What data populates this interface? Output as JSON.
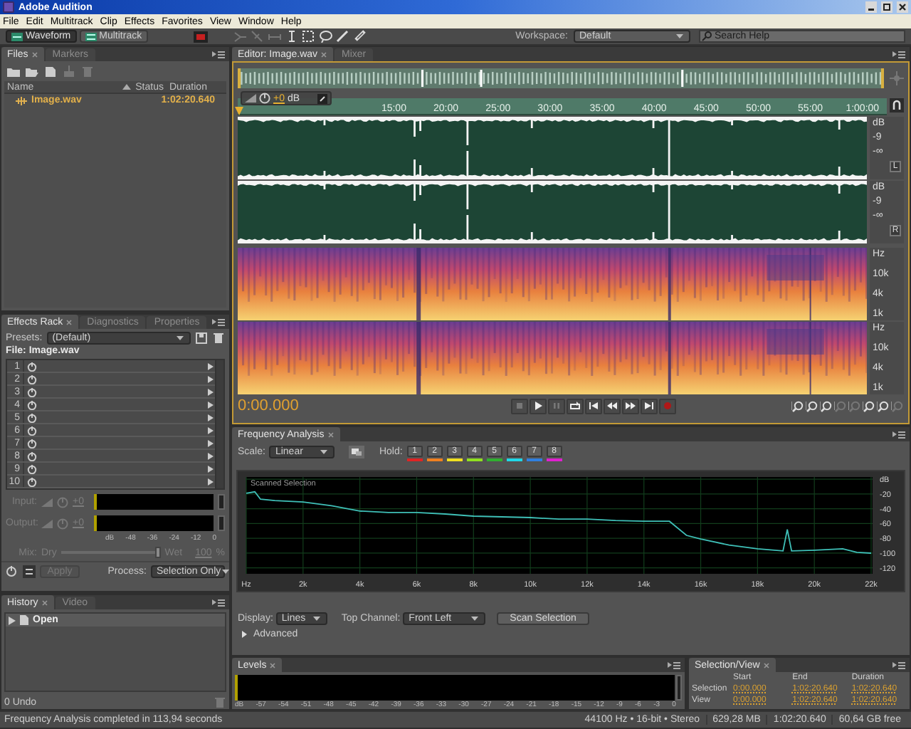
{
  "window": {
    "title": "Adobe Audition"
  },
  "menu": [
    "File",
    "Edit",
    "Multitrack",
    "Clip",
    "Effects",
    "Favorites",
    "View",
    "Window",
    "Help"
  ],
  "toolbar": {
    "views": [
      {
        "label": "Waveform",
        "selected": true
      },
      {
        "label": "Multitrack",
        "selected": false
      }
    ],
    "workspace_label": "Workspace:",
    "workspace": "Default",
    "search_placeholder": "Search Help"
  },
  "files_panel": {
    "tabs": [
      {
        "label": "Files",
        "selected": true
      },
      {
        "label": "Markers",
        "selected": false
      }
    ],
    "columns": [
      "Name",
      "Status",
      "Duration"
    ],
    "rows": [
      {
        "name": "Image.wav",
        "duration": "1:02:20.640"
      }
    ]
  },
  "effects_rack": {
    "tabs": [
      {
        "label": "Effects Rack",
        "selected": true
      },
      {
        "label": "Diagnostics",
        "selected": false
      },
      {
        "label": "Properties",
        "selected": false
      }
    ],
    "presets_label": "Presets:",
    "preset": "(Default)",
    "file_label": "File: Image.wav",
    "slots": [
      "1",
      "2",
      "3",
      "4",
      "5",
      "6",
      "7",
      "8",
      "9",
      "10"
    ],
    "input_label": "Input:",
    "input_value": "+0",
    "output_label": "Output:",
    "output_value": "+0",
    "meter_scale": [
      "dB",
      "-48",
      "-36",
      "-24",
      "-12",
      "0"
    ],
    "mix_label": "Mix:",
    "dry_label": "Dry",
    "wet_label": "Wet",
    "mix_slider": {
      "level": 1.0
    },
    "mix_value": "100",
    "mix_unit": "%",
    "apply": {
      "label": "Apply",
      "disabled": true
    },
    "process_label": "Process:",
    "process": "Selection Only"
  },
  "history": {
    "tabs": [
      {
        "label": "History",
        "selected": true
      },
      {
        "label": "Video",
        "selected": false
      }
    ],
    "items": [
      {
        "label": "Open"
      }
    ],
    "undo_count": "0 Undo"
  },
  "editor": {
    "tabs": [
      {
        "label": "Editor: Image.wav",
        "selected": true
      },
      {
        "label": "Mixer",
        "selected": false
      }
    ],
    "hud_gain": "+0",
    "hud_unit": "dB",
    "ruler": [
      "15:00",
      "20:00",
      "25:00",
      "30:00",
      "35:00",
      "40:00",
      "45:00",
      "50:00",
      "55:00",
      "1:00:00"
    ],
    "channels": [
      {
        "name": "L",
        "scale": [
          "dB",
          "-9",
          "-∞"
        ]
      },
      {
        "name": "R",
        "scale": [
          "dB",
          "-9",
          "-∞"
        ]
      }
    ],
    "spectral_scales": [
      [
        "Hz",
        "10k",
        "4k",
        "1k"
      ],
      [
        "Hz",
        "10k",
        "4k",
        "1k"
      ]
    ],
    "time": "0:00.000"
  },
  "frequency_analysis": {
    "title": "Frequency Analysis",
    "scale_label": "Scale:",
    "scale": "Linear",
    "hold_label": "Hold:",
    "holds": [
      {
        "label": "1",
        "color": "#e02424"
      },
      {
        "label": "2",
        "color": "#f08020"
      },
      {
        "label": "3",
        "color": "#f0e020"
      },
      {
        "label": "4",
        "color": "#90e020"
      },
      {
        "label": "5",
        "color": "#30b030"
      },
      {
        "label": "6",
        "color": "#20d8e8"
      },
      {
        "label": "7",
        "color": "#3080e0"
      },
      {
        "label": "8",
        "color": "#e020d0"
      }
    ],
    "chart_data": {
      "type": "line",
      "grid": true,
      "x": [
        0,
        300,
        500,
        1000,
        2000,
        3000,
        4000,
        5000,
        6000,
        7000,
        8000,
        9000,
        10000,
        11000,
        12000,
        13000,
        14000,
        14900,
        15500,
        16000,
        17000,
        18000,
        18900,
        19050,
        19200,
        20000,
        21000,
        21500,
        22000
      ],
      "series": [
        {
          "name": "Scanned Selection",
          "color": "#3fc0b8",
          "values": [
            -19,
            -17,
            -27,
            -29,
            -31,
            -36,
            -43,
            -45,
            -45,
            -47,
            -50,
            -51,
            -52,
            -54,
            -54,
            -56,
            -57,
            -57,
            -76,
            -81,
            -89,
            -94,
            -97,
            -68,
            -97,
            -96,
            -94,
            -99,
            -100
          ]
        }
      ],
      "xlim": [
        0,
        22050
      ],
      "ylim": [
        -128,
        3
      ],
      "xticks": [
        {
          "value": 0,
          "label": "Hz"
        },
        {
          "value": 2000,
          "label": "2k"
        },
        {
          "value": 4000,
          "label": "4k"
        },
        {
          "value": 6000,
          "label": "6k"
        },
        {
          "value": 8000,
          "label": "8k"
        },
        {
          "value": 10000,
          "label": "10k"
        },
        {
          "value": 12000,
          "label": "12k"
        },
        {
          "value": 14000,
          "label": "14k"
        },
        {
          "value": 16000,
          "label": "16k"
        },
        {
          "value": 18000,
          "label": "18k"
        },
        {
          "value": 20000,
          "label": "20k"
        },
        {
          "value": 22000,
          "label": "22k"
        }
      ],
      "yticks": [
        {
          "value": 0,
          "label": "dB"
        },
        -20,
        -40,
        -60,
        -80,
        -100,
        -120
      ]
    },
    "display_label": "Display:",
    "display": "Lines",
    "top_channel_label": "Top Channel:",
    "top_channel": "Front Left",
    "scan_button": "Scan Selection",
    "advanced": {
      "label": "Advanced",
      "expanded": false
    }
  },
  "levels": {
    "title": "Levels",
    "scale": [
      "dB",
      "-57",
      "-54",
      "-51",
      "-48",
      "-45",
      "-42",
      "-39",
      "-36",
      "-33",
      "-30",
      "-27",
      "-24",
      "-21",
      "-18",
      "-15",
      "-12",
      "-9",
      "-6",
      "-3",
      "0"
    ]
  },
  "selection_view": {
    "title": "Selection/View",
    "columns": [
      "Start",
      "End",
      "Duration"
    ],
    "rows": [
      {
        "label": "Selection",
        "start": "0:00.000",
        "end": "1:02:20.640",
        "duration": "1:02:20.640"
      },
      {
        "label": "View",
        "start": "0:00.000",
        "end": "1:02:20.640",
        "duration": "1:02:20.640"
      }
    ]
  },
  "status_bar": {
    "message": "Frequency Analysis completed in 113,94 seconds",
    "format": "44100 Hz • 16-bit • Stereo",
    "memory": "629,28 MB",
    "duration": "1:02:20.640",
    "free_space": "60,64 GB free"
  }
}
